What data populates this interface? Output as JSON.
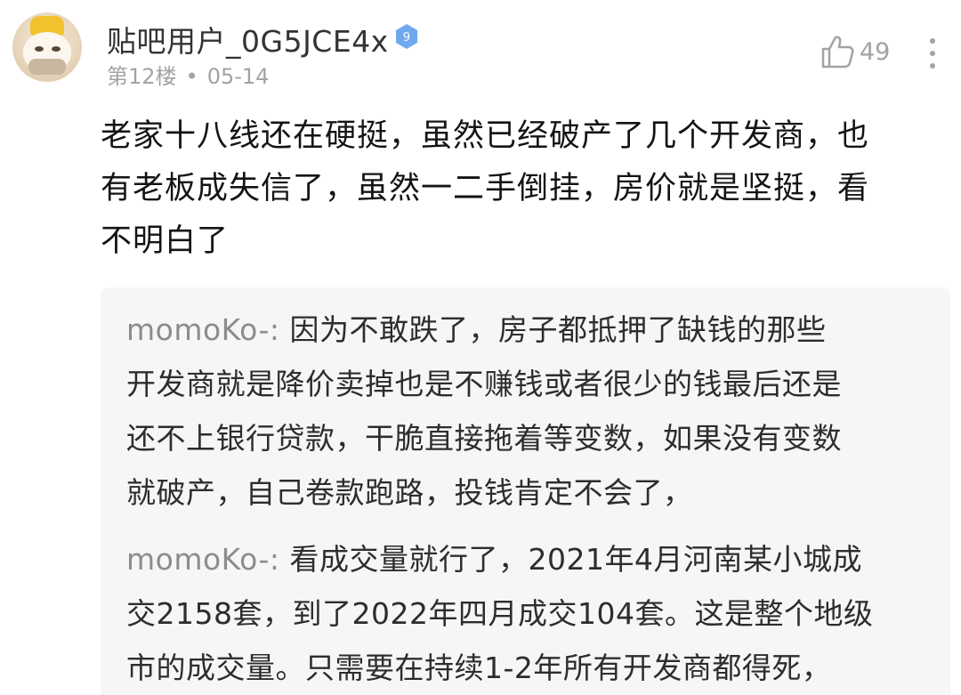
{
  "post": {
    "username": "贴吧用户_0G5JCE4x",
    "level": "9",
    "floor": "第12楼",
    "separator": "•",
    "date": "05-14",
    "like_count": "49",
    "content_lines": [
      "老家十八线还在硬挺，虽然已经破产了几个开发商，也",
      "有老板成失信了，虽然一二手倒挂，房价就是坚挺，看",
      "不明白了"
    ]
  },
  "replies": [
    {
      "author": "momoKo-:",
      "first_line": "因为不敢跌了，房子都抵押了缺钱的那些",
      "lines": [
        "开发商就是降价卖掉也是不赚钱或者很少的钱最后还是",
        "还不上银行贷款，干脆直接拖着等变数，如果没有变数",
        "就破产，自己卷款跑路，投钱肯定不会了，"
      ]
    },
    {
      "author": "momoKo-:",
      "first_line": "看成交量就行了，2021年4月河南某小城成",
      "lines": [
        "交2158套，到了2022年四月成交104套。这是整个地级",
        "市的成交量。只需要在持续1-2年所有开发商都得死，"
      ]
    }
  ],
  "icons": {
    "like": "thumbs-up-icon",
    "more": "vertical-ellipsis-icon",
    "level": "level-badge-icon"
  },
  "colors": {
    "level_badge": "#6fa8ee",
    "muted": "#a3a3a3",
    "reply_bg": "#f6f6f6"
  }
}
